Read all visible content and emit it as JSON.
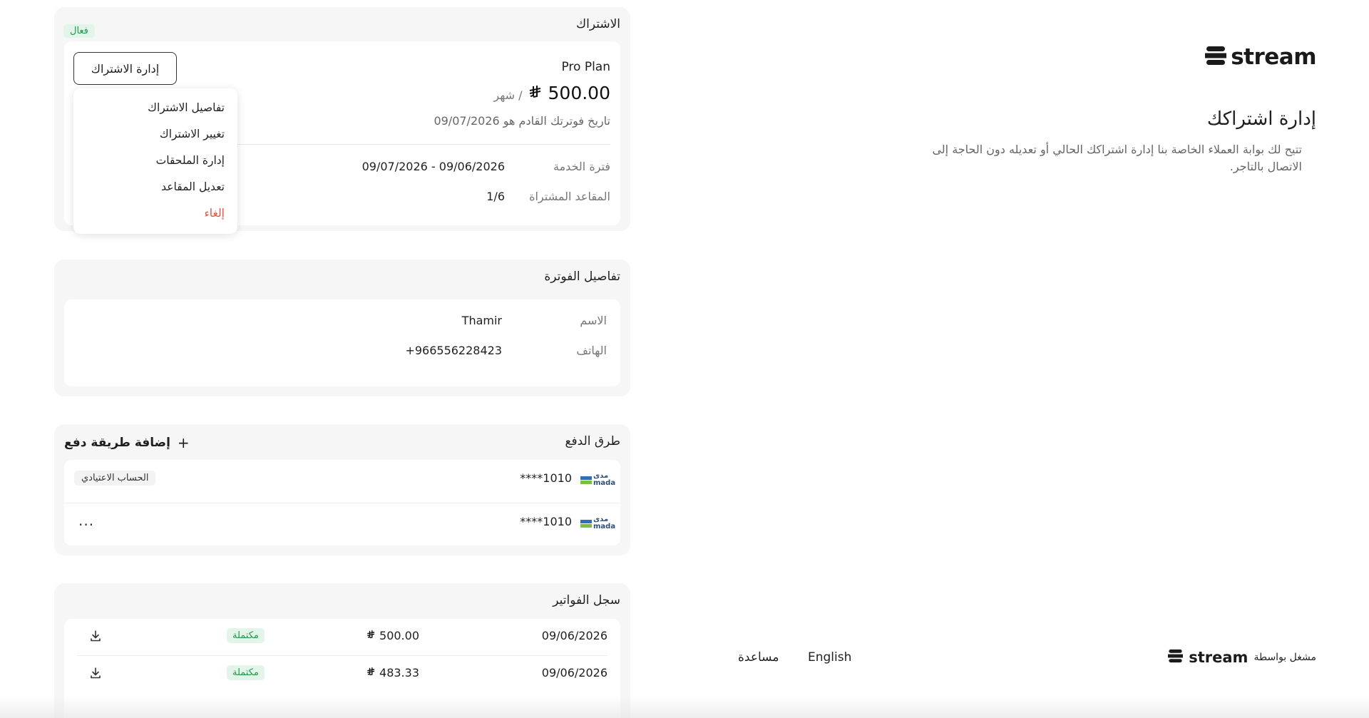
{
  "brand": {
    "logo_text": "stream"
  },
  "intro": {
    "title": "إدارة اشتراكك",
    "description": "تتيح لك بوابة العملاء الخاصة بنا إدارة اشتراكك الحالي أو تعديله دون الحاجة إلى الاتصال بالتاجر."
  },
  "subscription": {
    "title": "الاشتراك",
    "status": "فعال",
    "plan_name": "Pro Plan",
    "price": "500.00",
    "currency_symbol": "⃁",
    "period": "/ شهر",
    "next_invoice": "تاريخ فوترتك القادم هو 09/07/2026",
    "service_period_label": "فترة الخدمة",
    "service_period_value": "09/07/2026 - 09/06/2026",
    "seats_label": "المقاعد المشتراة",
    "seats_value": "1/6",
    "manage_button": "إدارة الاشتراك",
    "menu": {
      "details": "تفاصيل الاشتراك",
      "change": "تغيير الاشتراك",
      "addons": "إدارة الملحقات",
      "seats": "تعديل المقاعد",
      "cancel": "إلغاء"
    }
  },
  "invoice_details": {
    "title": "تفاصيل الفوترة",
    "name_label": "الاسم",
    "name_value": "Thamir",
    "phone_label": "الهاتف",
    "phone_value": "+966556228423"
  },
  "payment_methods": {
    "title": "طرق الدفع",
    "add_label": "إضافة طريقة دفع",
    "cards": [
      {
        "brand": "mada",
        "brand_ar": "مدى",
        "number": "****1010",
        "badge": "الحساب الاعتيادي"
      },
      {
        "brand": "mada",
        "brand_ar": "مدى",
        "number": "****1010",
        "more": "..."
      }
    ]
  },
  "invoice_history": {
    "title": "سجل الفواتير",
    "rows": [
      {
        "date": "09/06/2026",
        "amount": "500.00",
        "status": "مكتملة"
      },
      {
        "date": "09/06/2026",
        "amount": "483.33",
        "status": "مكتملة"
      }
    ]
  },
  "footer": {
    "powered_by": "مشغل بواسطة",
    "english": "English",
    "help": "مساعدة"
  },
  "colors": {
    "accent_green": "#1e9a4b",
    "badge_green_bg": "#e3f5e9",
    "danger": "#e2533d",
    "card_bg": "#f6f6f6"
  }
}
